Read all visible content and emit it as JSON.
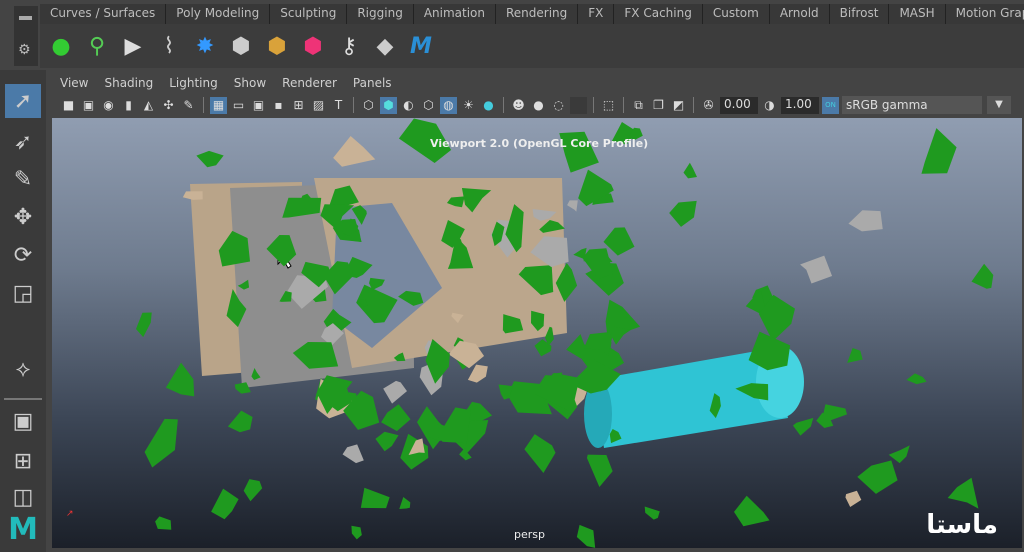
{
  "shelf": {
    "tabs": [
      "Curves / Surfaces",
      "Poly Modeling",
      "Sculpting",
      "Rigging",
      "Animation",
      "Rendering",
      "FX",
      "FX Caching",
      "Custom",
      "Arnold",
      "Bifrost",
      "MASH",
      "Motion Graphics"
    ],
    "icons": [
      "bowling-pins-icon",
      "rigid-body-icon",
      "play-settings-icon",
      "broom-icon",
      "particle-icon",
      "shatter-gray-icon",
      "shatter-gold-icon",
      "shatter-color-icon",
      "key-icon",
      "crumble-icon",
      "mash-logo-icon"
    ]
  },
  "panel": {
    "menu": [
      "View",
      "Shading",
      "Lighting",
      "Show",
      "Renderer",
      "Panels"
    ],
    "exposure": "0.00",
    "gamma": "1.00",
    "color_management": "sRGB gamma",
    "cm_toggle": "ON"
  },
  "viewport": {
    "title": "Viewport 2.0 (OpenGL Core Profile)",
    "camera": "persp",
    "watermark": "ماستا"
  },
  "colors": {
    "selected": "#4b7aa8",
    "fragments": "#1f9a1f",
    "cylinder": "#2fc4d4",
    "wall": "#b9a489"
  }
}
